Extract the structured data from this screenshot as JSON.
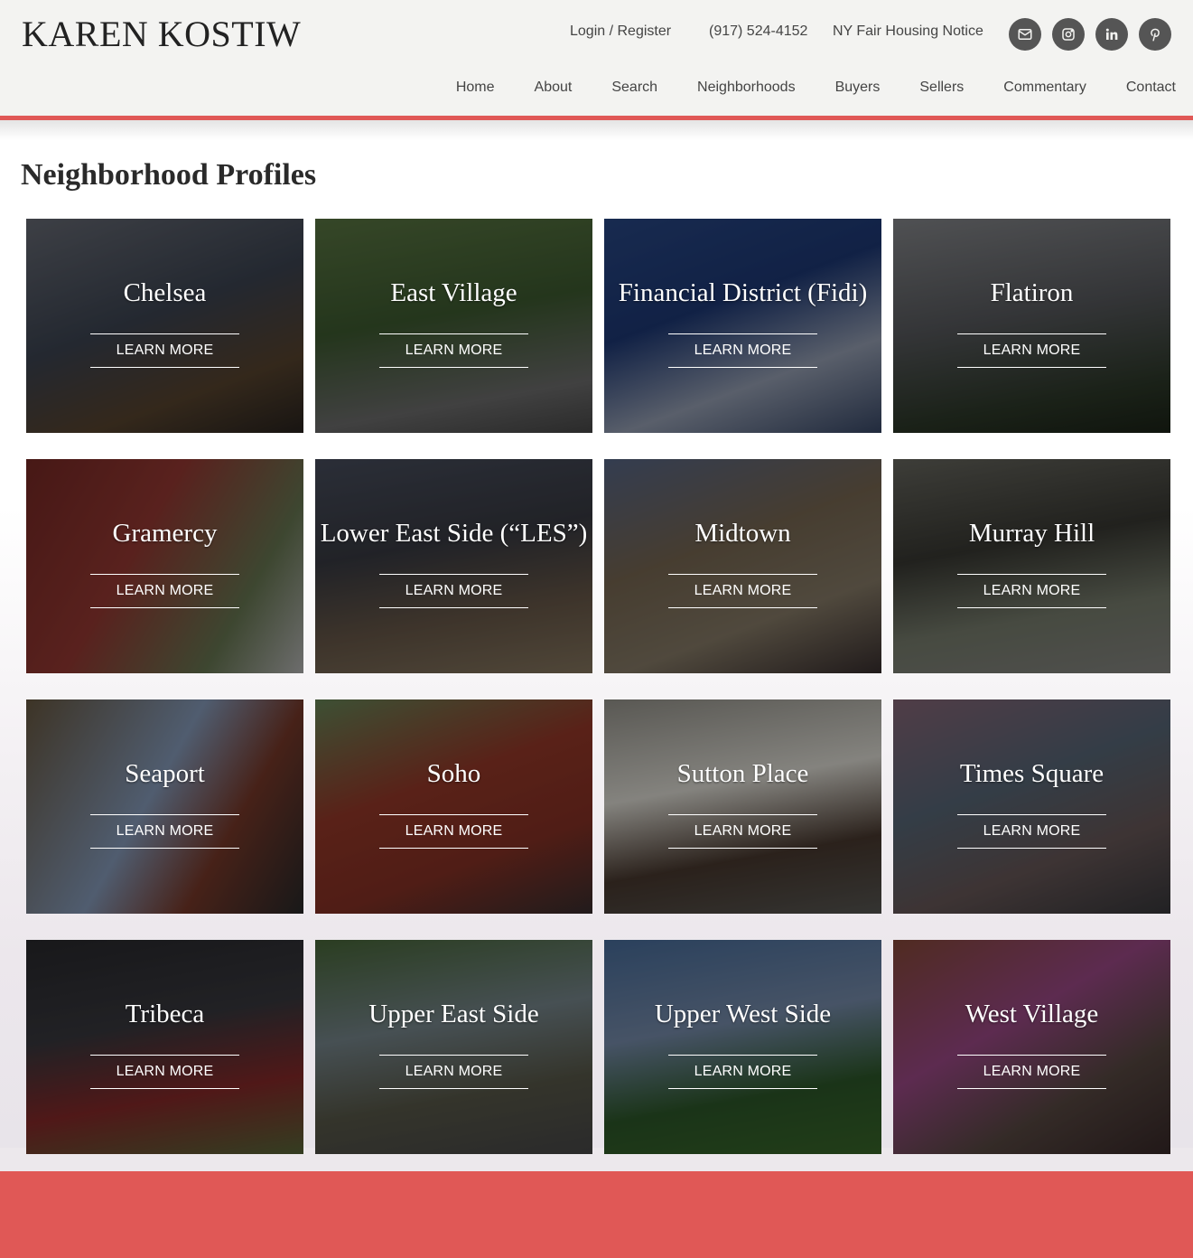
{
  "brand": {
    "name": "KAREN KOSTIW",
    "accent": "#e05856"
  },
  "utility": {
    "login": "Login / Register",
    "phone": "(917) 524-4152",
    "fair_housing": "NY Fair Housing Notice"
  },
  "social": [
    {
      "name": "email-icon"
    },
    {
      "name": "instagram-icon"
    },
    {
      "name": "linkedin-icon"
    },
    {
      "name": "pinterest-icon"
    }
  ],
  "nav": [
    "Home",
    "About",
    "Search",
    "Neighborhoods",
    "Buyers",
    "Sellers",
    "Commentary",
    "Contact"
  ],
  "page": {
    "title": "Neighborhood Profiles"
  },
  "cta_label": "LEARN MORE",
  "neighborhoods": [
    {
      "name": "Chelsea"
    },
    {
      "name": "East Village"
    },
    {
      "name": "Financial District (Fidi)"
    },
    {
      "name": "Flatiron"
    },
    {
      "name": "Gramercy"
    },
    {
      "name": "Lower East Side (“LES”)"
    },
    {
      "name": "Midtown"
    },
    {
      "name": "Murray Hill"
    },
    {
      "name": "Seaport"
    },
    {
      "name": "Soho"
    },
    {
      "name": "Sutton Place"
    },
    {
      "name": "Times Square"
    },
    {
      "name": "Tribeca"
    },
    {
      "name": "Upper East Side"
    },
    {
      "name": "Upper West Side"
    },
    {
      "name": "West Village"
    }
  ]
}
